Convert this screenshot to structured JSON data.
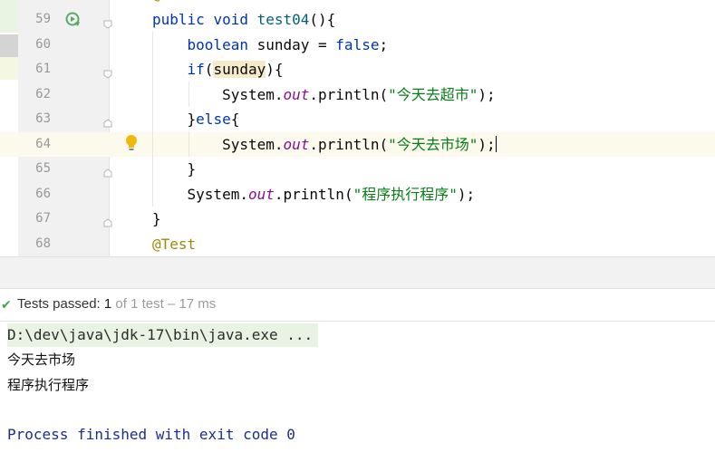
{
  "editor": {
    "lines": [
      {
        "no": "59",
        "parts": [
          [
            "kw",
            "public "
          ],
          [
            "kw",
            "void "
          ],
          [
            "fn",
            "test04"
          ],
          [
            "",
            "(){"
          ]
        ]
      },
      {
        "no": "60",
        "parts": [
          [
            "",
            "    "
          ],
          [
            "kw",
            "boolean "
          ],
          [
            "",
            "sunday = "
          ],
          [
            "kw",
            "false"
          ],
          [
            "",
            ";"
          ]
        ]
      },
      {
        "no": "61",
        "parts": [
          [
            "",
            "    "
          ],
          [
            "kw",
            "if"
          ],
          [
            "",
            "("
          ],
          [
            "hl",
            "sunday"
          ],
          [
            "",
            "){"
          ]
        ]
      },
      {
        "no": "62",
        "parts": [
          [
            "",
            "        System."
          ],
          [
            "fld",
            "out"
          ],
          [
            "",
            ".println("
          ],
          [
            "str",
            "\"今天去超市\""
          ],
          [
            "",
            ");"
          ]
        ]
      },
      {
        "no": "63",
        "parts": [
          [
            "",
            "    }"
          ],
          [
            "kw",
            "else"
          ],
          [
            "",
            "{"
          ]
        ]
      },
      {
        "no": "64",
        "parts": [
          [
            "",
            "        System."
          ],
          [
            "fld",
            "out"
          ],
          [
            "",
            ".println("
          ],
          [
            "str",
            "\"今天去市场\""
          ],
          [
            "",
            ");"
          ]
        ]
      },
      {
        "no": "65",
        "parts": [
          [
            "",
            "    }"
          ]
        ]
      },
      {
        "no": "66",
        "parts": [
          [
            "",
            "    System."
          ],
          [
            "fld",
            "out"
          ],
          [
            "",
            ".println("
          ],
          [
            "str",
            "\"程序执行程序\""
          ],
          [
            "",
            ");"
          ]
        ]
      },
      {
        "no": "67",
        "parts": [
          [
            "",
            "}"
          ]
        ]
      },
      {
        "no": "68",
        "parts": [
          [
            "ann",
            "@Test"
          ]
        ]
      }
    ],
    "current_line": "64"
  },
  "run_status": {
    "label": "Tests passed:",
    "count": "1",
    "detail": "of 1 test – 17 ms"
  },
  "console": {
    "command": "D:\\dev\\java\\jdk-17\\bin\\java.exe ...",
    "output": [
      "今天去市场",
      "程序执行程序"
    ],
    "exit": "Process finished with exit code 0"
  },
  "icons": {
    "run": "run-test-icon",
    "bulb": "intention-bulb-icon",
    "check": "check-icon"
  },
  "colors": {
    "keyword": "#0033b3",
    "string": "#067d17",
    "field": "#871094",
    "annotation": "#9e880d",
    "current_line": "#fcfaed",
    "check": "#4aa34a"
  }
}
